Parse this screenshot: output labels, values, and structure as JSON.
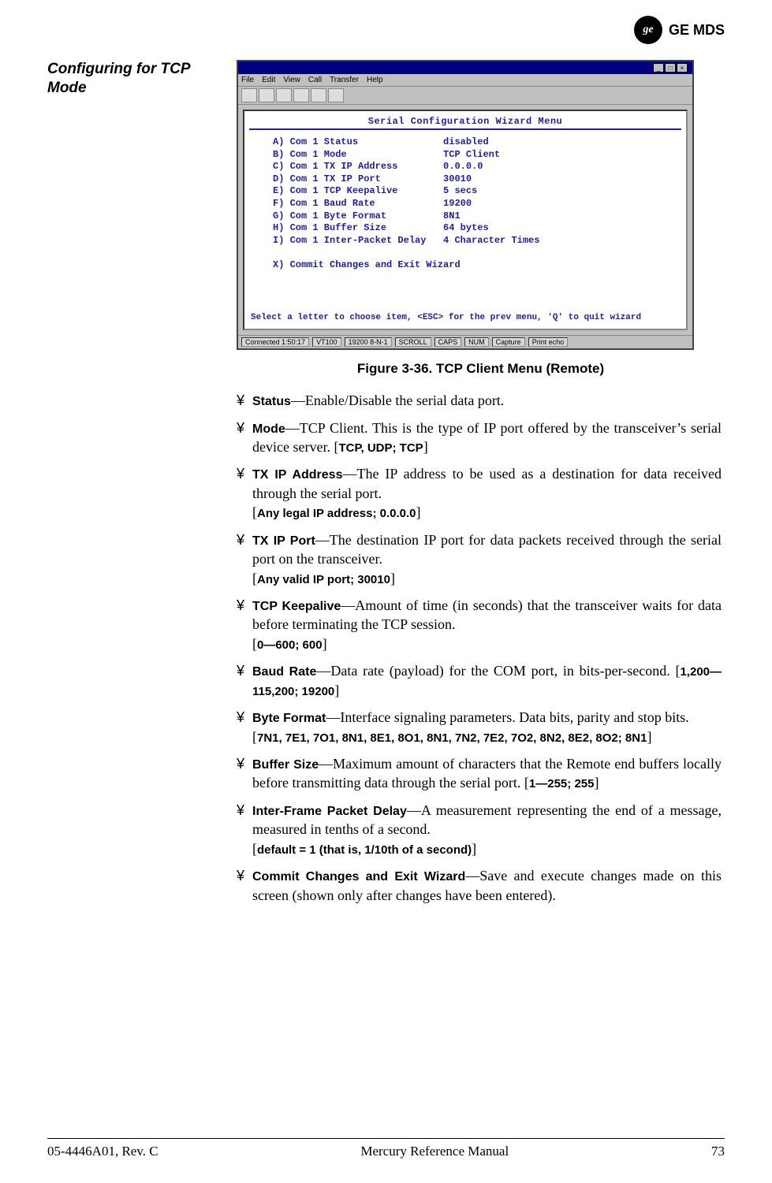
{
  "header": {
    "logo_monogram": "ge",
    "logo_text": "GE MDS"
  },
  "side_title": "Configuring for TCP Mode",
  "terminal": {
    "titlebar": "",
    "menus": [
      "File",
      "Edit",
      "View",
      "Call",
      "Transfer",
      "Help"
    ],
    "menu_title": "Serial Configuration Wizard Menu",
    "items": [
      {
        "key": "A)",
        "label": "Com 1 Status",
        "value": "disabled"
      },
      {
        "key": "B)",
        "label": "Com 1 Mode",
        "value": "TCP Client"
      },
      {
        "key": "C)",
        "label": "Com 1 TX IP Address",
        "value": "0.0.0.0"
      },
      {
        "key": "D)",
        "label": "Com 1 TX IP Port",
        "value": "30010"
      },
      {
        "key": "E)",
        "label": "Com 1 TCP Keepalive",
        "value": "5 secs"
      },
      {
        "key": "F)",
        "label": "Com 1 Baud Rate",
        "value": "19200"
      },
      {
        "key": "G)",
        "label": "Com 1 Byte Format",
        "value": "8N1"
      },
      {
        "key": "H)",
        "label": "Com 1 Buffer Size",
        "value": "64 bytes"
      },
      {
        "key": "I)",
        "label": "Com 1 Inter-Packet Delay",
        "value": "4 Character Times"
      },
      {
        "key": "X)",
        "label": "Commit Changes and Exit Wizard",
        "value": ""
      }
    ],
    "footer": "Select a letter to choose item, <ESC> for the prev menu, 'Q' to quit wizard",
    "status": [
      "Connected 1:50:17",
      "VT100",
      "19200 8-N-1",
      "SCROLL",
      "CAPS",
      "NUM",
      "Capture",
      "Print echo"
    ]
  },
  "figure_caption": "Figure 3-36. TCP Client Menu (Remote)",
  "bullets": [
    {
      "term": "Status",
      "desc": "—Enable/Disable the serial data port."
    },
    {
      "term": "Mode",
      "desc": "—TCP Client. This is the type of IP port offered by the transceiver’s serial device server. [",
      "range": "TCP, UDP; TCP",
      "desc2": "]"
    },
    {
      "term": "TX IP Address",
      "desc": "—The IP address to be used as a destination for data received through the serial port.",
      "range_line": "Any legal IP address; 0.0.0.0"
    },
    {
      "term": "TX IP Port",
      "desc": "—The destination IP port for data packets received through the serial port on the transceiver.",
      "range_line": "Any valid IP port; 30010"
    },
    {
      "term": "TCP Keepalive",
      "desc": "—Amount of time (in seconds) that the transceiver waits for data before terminating the TCP session.",
      "range_line": "0—600; 600"
    },
    {
      "term": "Baud Rate",
      "desc": "—Data rate (payload) for the COM port, in bits-per-second. [",
      "range": "1,200—115,200; 19200",
      "desc2": "]"
    },
    {
      "term": "Byte Format",
      "desc": "—Interface signaling parameters. Data bits, parity and stop bits.",
      "range_line": "7N1, 7E1, 7O1, 8N1, 8E1, 8O1, 8N1, 7N2, 7E2, 7O2, 8N2, 8E2, 8O2; 8N1"
    },
    {
      "term": "Buffer Size",
      "desc": "—Maximum amount of characters that the Remote end buffers locally before transmitting data through the serial port. [",
      "range": "1—255; 255",
      "desc2": "]"
    },
    {
      "term": "Inter-Frame Packet Delay",
      "desc": "—A measurement representing the end of a message, measured in tenths of a second.",
      "range_line": "default = 1 (that is, 1/10th of a second)"
    },
    {
      "term": "Commit Changes and Exit Wizard",
      "desc": "—Save and execute changes made on this screen (shown only after changes have been entered)."
    }
  ],
  "footer": {
    "left": "05-4446A01, Rev. C",
    "center": "Mercury Reference Manual",
    "right": "73"
  }
}
